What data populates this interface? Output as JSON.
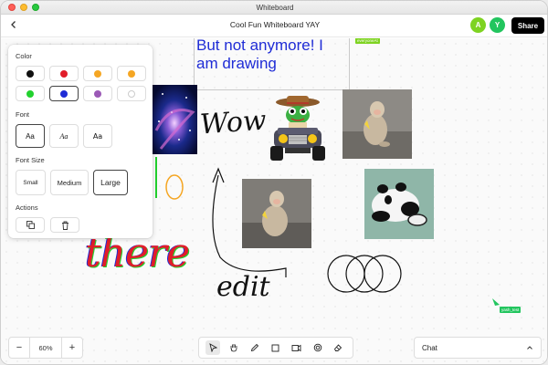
{
  "window": {
    "title": "Whiteboard"
  },
  "topbar": {
    "back_icon": "chevron-left-icon",
    "board_title": "Cool Fun Whiteboard YAY",
    "avatars": [
      {
        "initial": "A",
        "color": "#7ed321"
      },
      {
        "initial": "Y",
        "color": "#22c55e"
      }
    ],
    "share_label": "Share"
  },
  "canvas": {
    "text_box": "But not anymore! I am drawing",
    "text_box_color": "#1f2cd6",
    "cursor_tags": [
      {
        "label": "everyoneAt",
        "color": "#7ed321"
      },
      {
        "label": "yash_test",
        "color": "#22c55e"
      }
    ],
    "handwriting": {
      "wow": "Wow",
      "edit": "edit",
      "there": "there",
      "zero": "0"
    },
    "images": [
      "galaxy-painting",
      "cowboy-frog-car",
      "monkey-with-banana",
      "monkey-with-banana",
      "panda-with-bowl"
    ]
  },
  "panel": {
    "color_label": "Color",
    "colors": [
      "#111111",
      "#e11d2a",
      "#f5a623",
      "#f5a623",
      "#22d12e",
      "#1f2cd6",
      "#9b59b6",
      "#ffffff"
    ],
    "selected_color_index": 5,
    "font_label": "Font",
    "fonts": [
      "Aa",
      "Aa",
      "Aa"
    ],
    "selected_font_index": 0,
    "font_size_label": "Font Size",
    "sizes": [
      "Small",
      "Medium",
      "Large"
    ],
    "selected_size_index": 2,
    "actions_label": "Actions",
    "actions": [
      "duplicate-icon",
      "trash-icon"
    ]
  },
  "zoom": {
    "minus": "−",
    "value": "60%",
    "plus": "+"
  },
  "toolbar": {
    "tools": [
      "pointer-icon",
      "hand-icon",
      "pen-icon",
      "square-icon",
      "sticky-note-icon",
      "shapes-icon",
      "eraser-icon"
    ],
    "active_index": 0
  },
  "chat": {
    "label": "Chat",
    "chevron_icon": "chevron-up-icon"
  }
}
